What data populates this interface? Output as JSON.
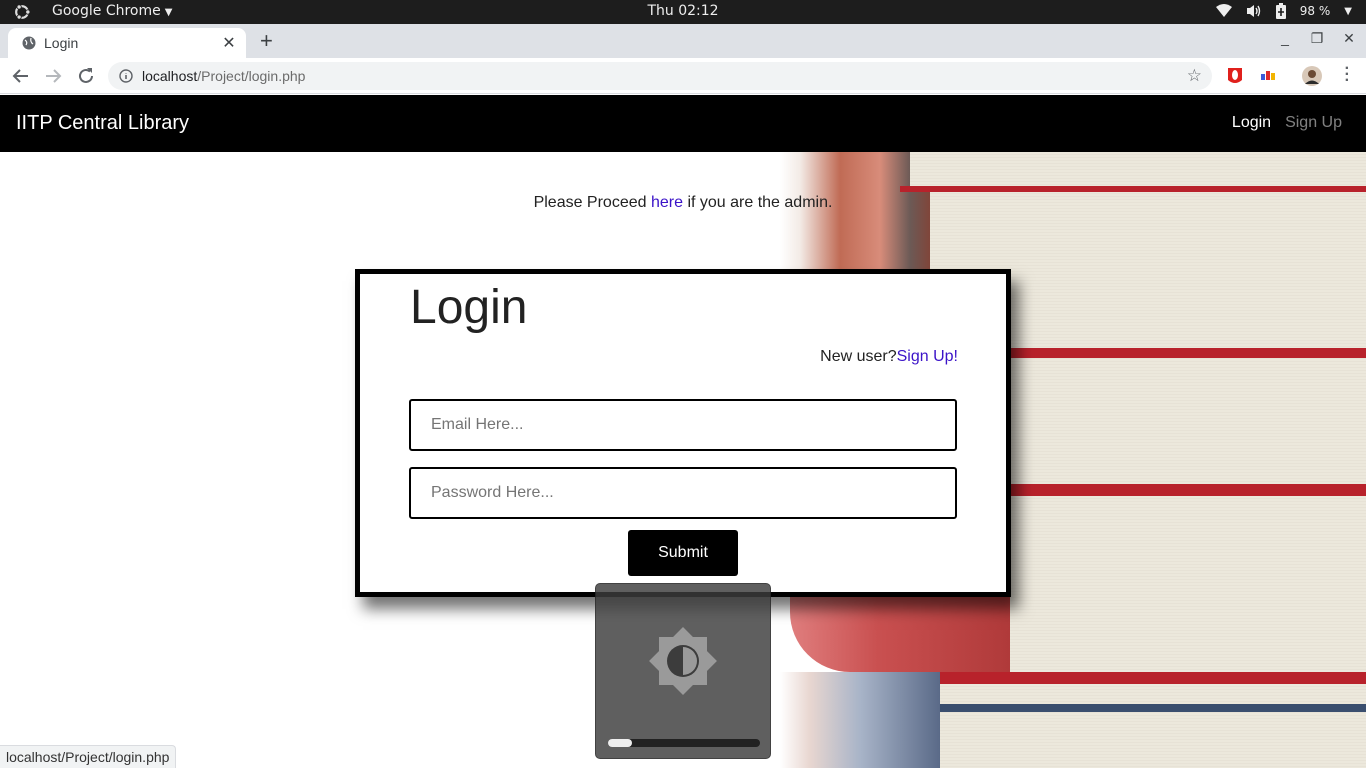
{
  "os_bar": {
    "app_name": "Google Chrome",
    "clock": "Thu 02:12",
    "battery": "98 %"
  },
  "browser": {
    "tab_title": "Login",
    "url_host": "localhost",
    "url_path": "/Project/login.php",
    "status_url": "localhost/Project/login.php"
  },
  "navbar": {
    "brand": "IITP Central Library",
    "links": [
      "Login",
      "Sign Up"
    ]
  },
  "admin_notice": {
    "prefix": "Please Proceed ",
    "link": "here",
    "suffix": " if you are the admin."
  },
  "login_form": {
    "title": "Login",
    "new_user_text": "New user?",
    "signup_link": "Sign Up!",
    "email_placeholder": "Email Here...",
    "password_placeholder": "Password Here...",
    "submit_label": "Submit"
  },
  "brightness_osd": {
    "level": 0.16
  },
  "colors": {
    "link": "#3b13c8",
    "navbar_bg": "#000000"
  }
}
